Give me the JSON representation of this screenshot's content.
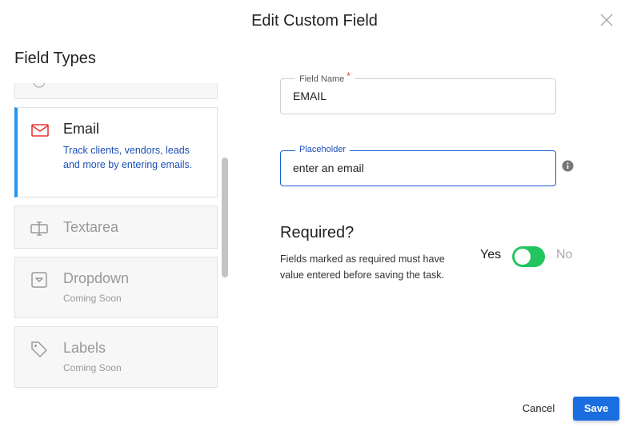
{
  "dialog": {
    "title": "Edit Custom Field",
    "close_icon": "close-icon"
  },
  "field_types": {
    "heading": "Field Types",
    "items": [
      {
        "icon": "partial-icon",
        "name": "",
        "state": "partial"
      },
      {
        "icon": "mail-icon",
        "name": "Email",
        "description": "Track clients, vendors, leads and more by entering emails.",
        "state": "selected"
      },
      {
        "icon": "textarea-icon",
        "name": "Textarea",
        "state": "default"
      },
      {
        "icon": "dropdown-icon",
        "name": "Dropdown",
        "sub": "Coming Soon",
        "state": "disabled"
      },
      {
        "icon": "tag-icon",
        "name": "Labels",
        "sub": "Coming Soon",
        "state": "disabled"
      }
    ]
  },
  "form": {
    "field_name": {
      "label": "Field Name",
      "required_marker": "*",
      "value": "EMAIL"
    },
    "placeholder": {
      "label": "Placeholder",
      "value": "enter an email"
    },
    "info_icon": "info-icon"
  },
  "required": {
    "heading": "Required?",
    "help": "Fields marked as required must have value entered before saving the task.",
    "yes_label": "Yes",
    "no_label": "No",
    "value": true
  },
  "footer": {
    "cancel_label": "Cancel",
    "save_label": "Save"
  },
  "colors": {
    "accent": "#1a6ee0",
    "selected_border": "#2196f3",
    "toggle_on": "#22c55e",
    "email_icon": "#e53935",
    "description_text": "#1a4fb8"
  }
}
